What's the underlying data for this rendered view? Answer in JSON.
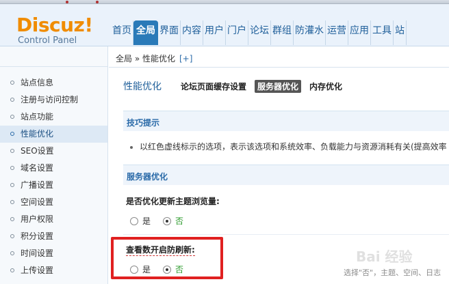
{
  "header": {
    "logo_name": "Discuz!",
    "logo_sub": "Control Panel"
  },
  "nav": {
    "items": [
      "首页",
      "全局",
      "界面",
      "内容",
      "用户",
      "门户",
      "论坛",
      "群组",
      "防灌水",
      "运营",
      "应用",
      "工具",
      "站"
    ]
  },
  "breadcrumb": {
    "text": "全局 » 性能优化",
    "plus": "[+]"
  },
  "sidebar": {
    "items": [
      "站点信息",
      "注册与访问控制",
      "站点功能",
      "性能优化",
      "SEO设置",
      "域名设置",
      "广播设置",
      "空间设置",
      "用户权限",
      "积分设置",
      "时间设置",
      "上传设置"
    ]
  },
  "main": {
    "title": "性能优化",
    "tabs": [
      "论坛页面缓存设置",
      "服务器优化",
      "内存优化"
    ],
    "tips_header": "技巧提示",
    "tip_text": "以红色虚线标示的选项，表示该选项和系统效率、负载能力与资源消耗有关(提高效率",
    "server_header": "服务器优化",
    "setting1": {
      "label": "是否优化更新主题浏览量:",
      "yes": "是",
      "no": "否"
    },
    "setting2": {
      "label": "查看数开启防刷新:",
      "yes": "是",
      "no": "否"
    },
    "hint": "选择\"否\"，主题、空间、日志"
  },
  "watermark": "Bai 经验"
}
